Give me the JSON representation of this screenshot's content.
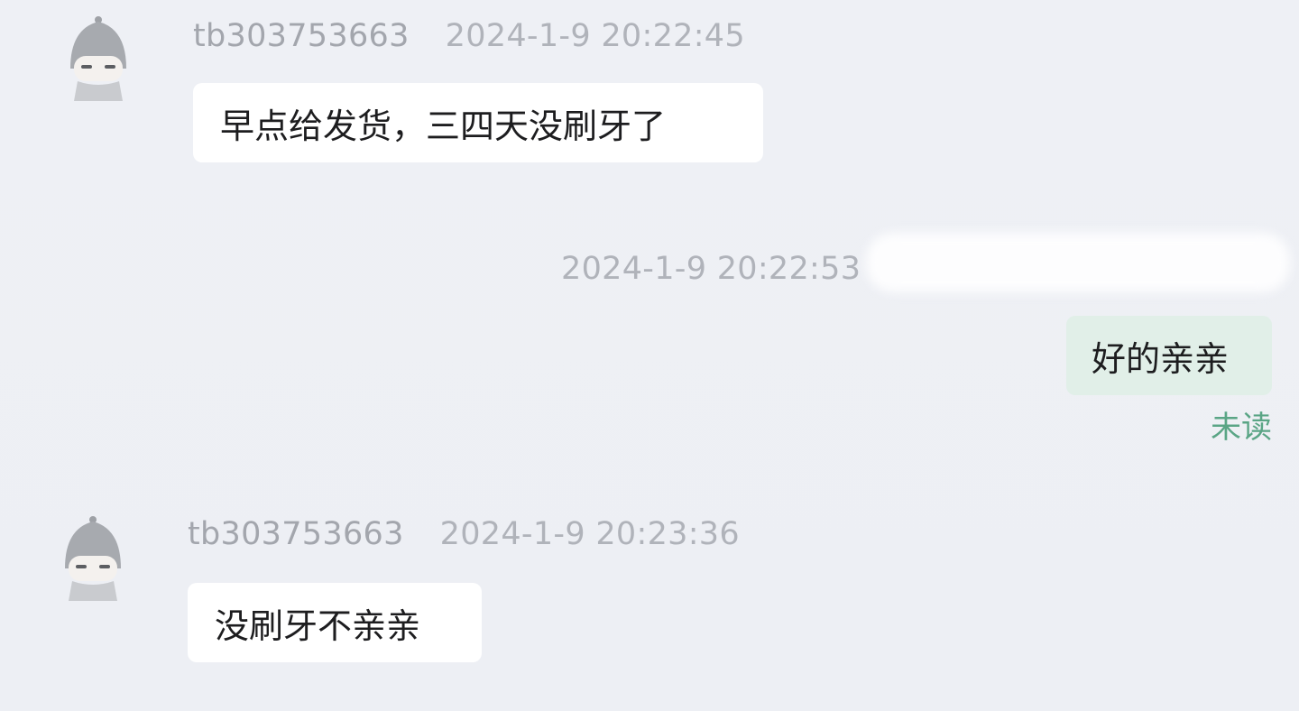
{
  "messages": [
    {
      "sender": "tb303753663",
      "time": "2024-1-9 20:22:45",
      "text": "早点给发货，三四天没刷牙了"
    },
    {
      "time": "2024-1-9 20:22:53",
      "text": "好的亲亲",
      "status": "未读"
    },
    {
      "sender": "tb303753663",
      "time": "2024-1-9 20:23:36",
      "text": "没刷牙不亲亲"
    }
  ],
  "colors": {
    "background": "#eef0f5",
    "incoming_bubble": "#ffffff",
    "outgoing_bubble": "#e1efe8",
    "unread_status": "#5aa585",
    "meta_text": "#a8abb2"
  }
}
